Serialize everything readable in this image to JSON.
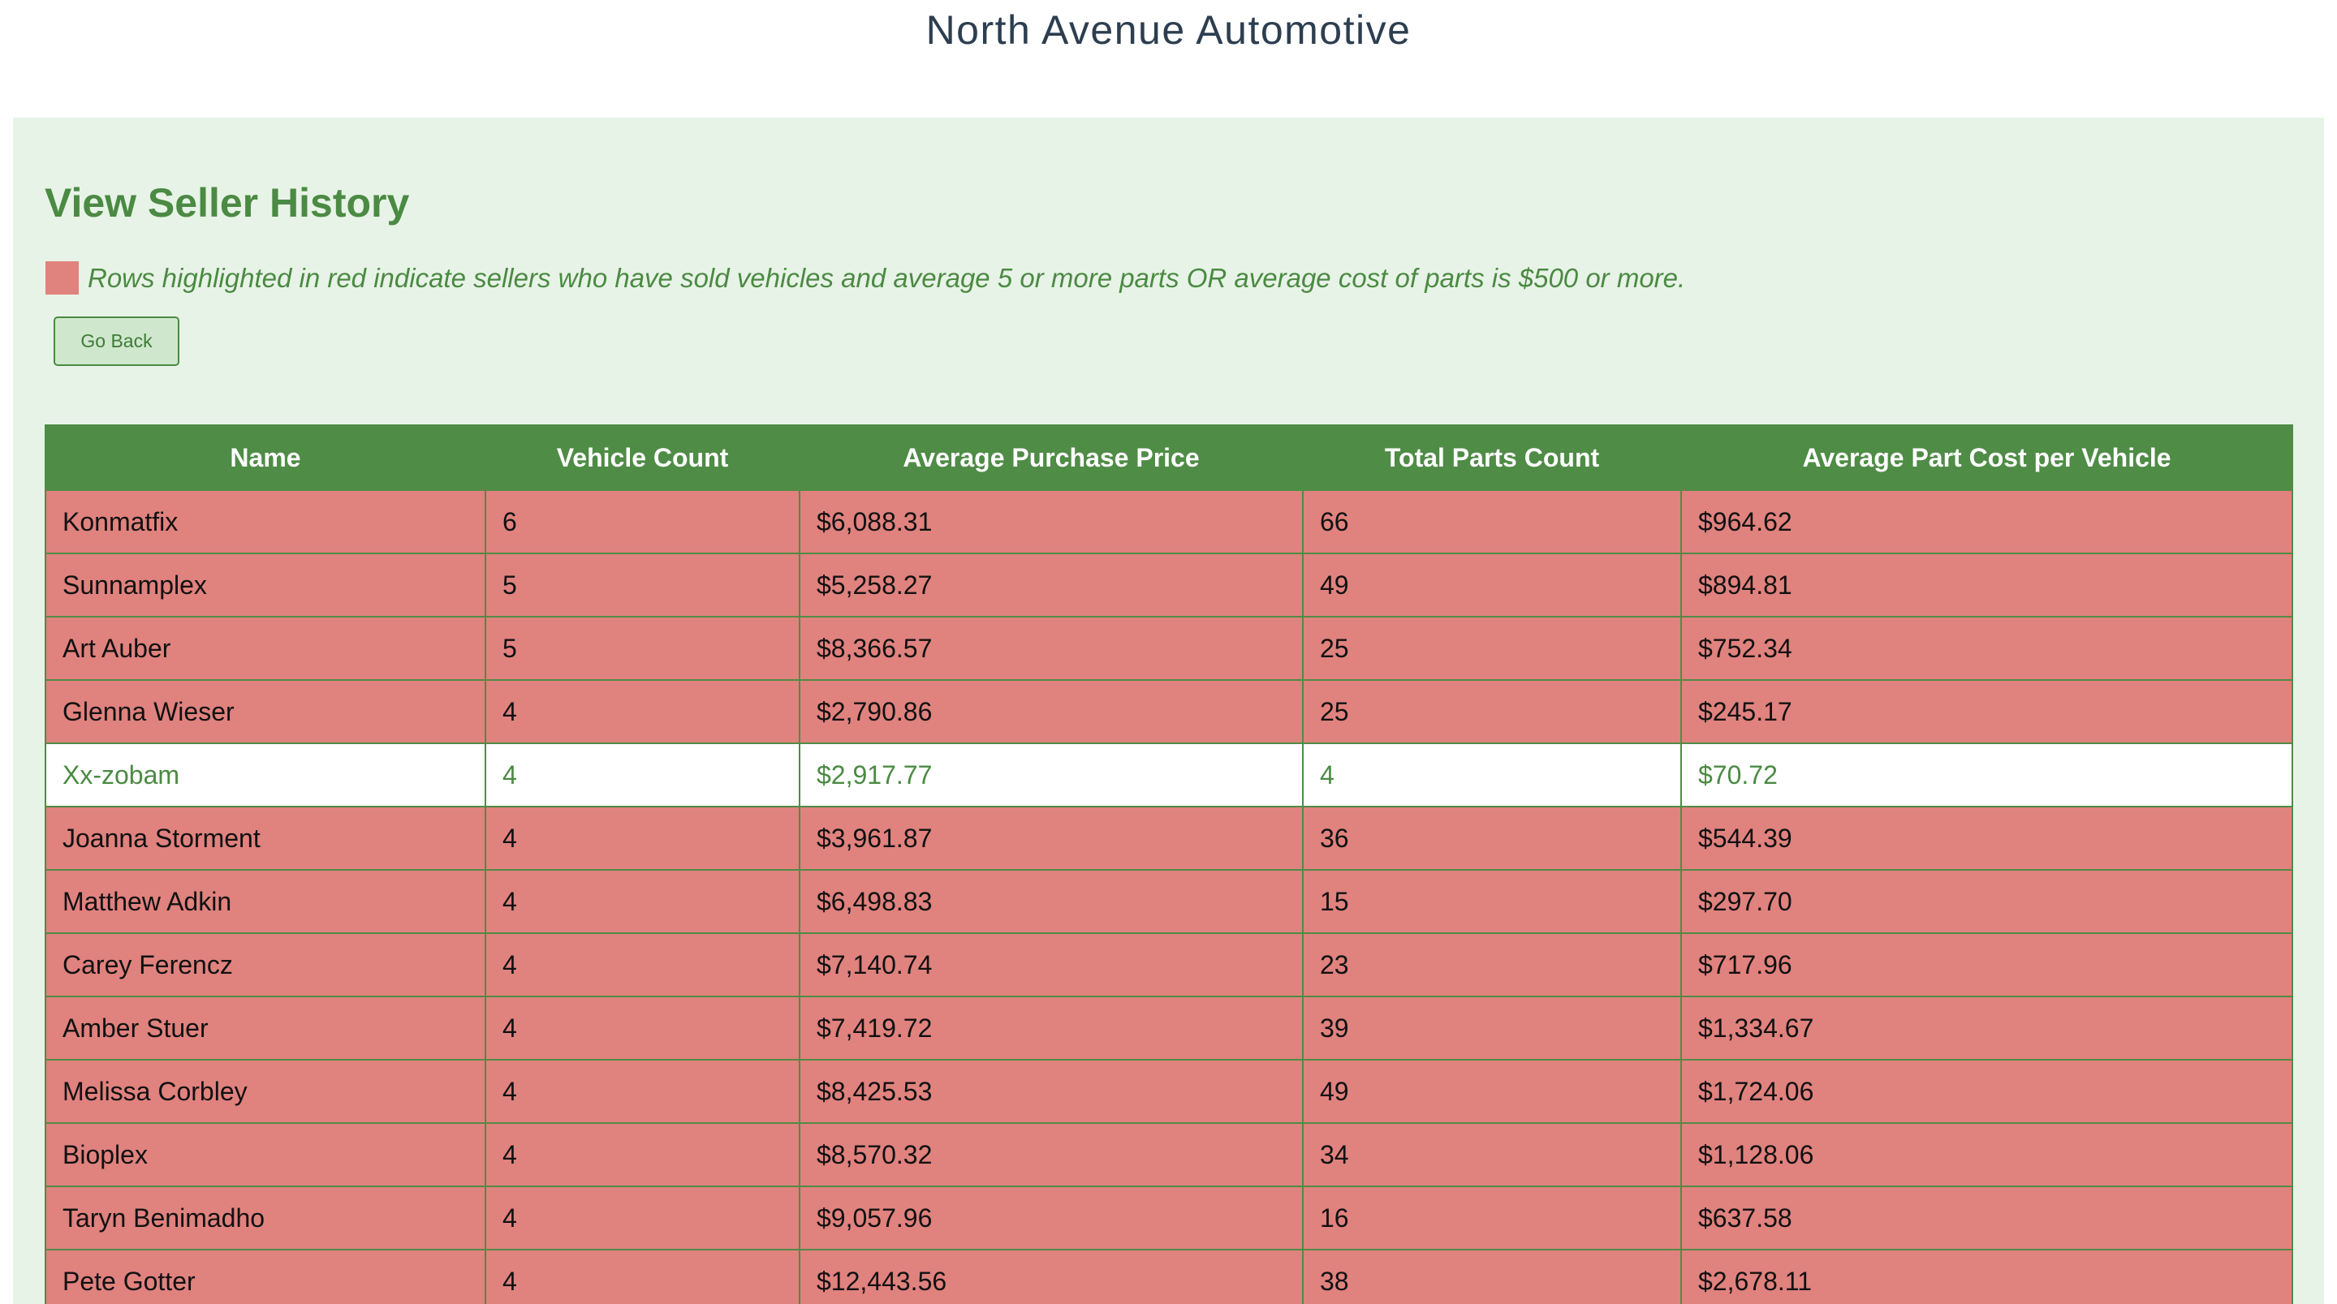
{
  "site": {
    "title": "North Avenue Automotive"
  },
  "page": {
    "heading": "View Seller History",
    "legend_text": "Rows highlighted in red indicate sellers who have sold vehicles and average 5 or more parts OR average cost of parts is $500 or more.",
    "go_back_label": "Go Back"
  },
  "colors": {
    "highlight_row": "#e0827e",
    "header_green": "#4f8c46",
    "panel_background": "#e8f3e7",
    "title_text": "#2c3e50"
  },
  "table": {
    "headers": [
      "Name",
      "Vehicle Count",
      "Average Purchase Price",
      "Total Parts Count",
      "Average Part Cost per Vehicle"
    ],
    "rows": [
      {
        "highlighted": true,
        "cells": [
          "Konmatfix",
          "6",
          "$6,088.31",
          "66",
          "$964.62"
        ]
      },
      {
        "highlighted": true,
        "cells": [
          "Sunnamplex",
          "5",
          "$5,258.27",
          "49",
          "$894.81"
        ]
      },
      {
        "highlighted": true,
        "cells": [
          "Art Auber",
          "5",
          "$8,366.57",
          "25",
          "$752.34"
        ]
      },
      {
        "highlighted": true,
        "cells": [
          "Glenna Wieser",
          "4",
          "$2,790.86",
          "25",
          "$245.17"
        ]
      },
      {
        "highlighted": false,
        "cells": [
          "Xx-zobam",
          "4",
          "$2,917.77",
          "4",
          "$70.72"
        ]
      },
      {
        "highlighted": true,
        "cells": [
          "Joanna Storment",
          "4",
          "$3,961.87",
          "36",
          "$544.39"
        ]
      },
      {
        "highlighted": true,
        "cells": [
          "Matthew Adkin",
          "4",
          "$6,498.83",
          "15",
          "$297.70"
        ]
      },
      {
        "highlighted": true,
        "cells": [
          "Carey Ferencz",
          "4",
          "$7,140.74",
          "23",
          "$717.96"
        ]
      },
      {
        "highlighted": true,
        "cells": [
          "Amber Stuer",
          "4",
          "$7,419.72",
          "39",
          "$1,334.67"
        ]
      },
      {
        "highlighted": true,
        "cells": [
          "Melissa Corbley",
          "4",
          "$8,425.53",
          "49",
          "$1,724.06"
        ]
      },
      {
        "highlighted": true,
        "cells": [
          "Bioplex",
          "4",
          "$8,570.32",
          "34",
          "$1,128.06"
        ]
      },
      {
        "highlighted": true,
        "cells": [
          "Taryn Benimadho",
          "4",
          "$9,057.96",
          "16",
          "$637.58"
        ]
      },
      {
        "highlighted": true,
        "cells": [
          "Pete Gotter",
          "4",
          "$12,443.56",
          "38",
          "$2,678.11"
        ]
      }
    ]
  }
}
